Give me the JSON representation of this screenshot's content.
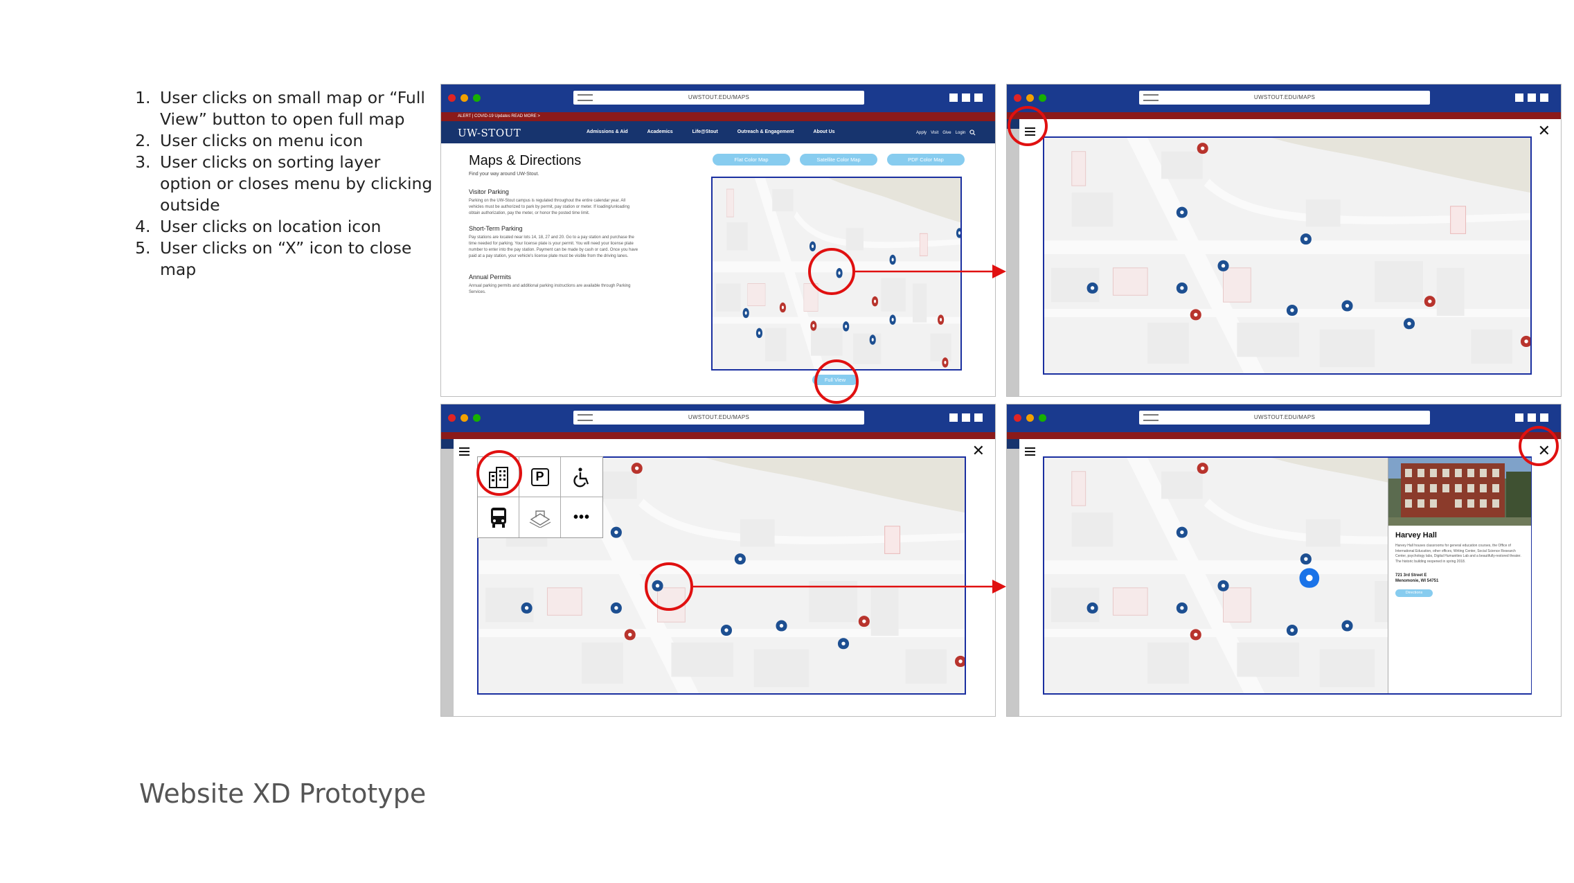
{
  "steps": [
    "User clicks on small map or “Full View” button to open full map",
    "User clicks on menu icon",
    "User clicks on sorting layer option or closes menu by clicking outside",
    "User clicks on location icon",
    "User clicks on “X” icon to close map"
  ],
  "caption": "Website XD Prototype",
  "browser": {
    "url": "UWSTOUT.EDU/MAPS"
  },
  "site": {
    "alert": "ALERT | COVID-19 Updates READ MORE >",
    "logo": "UW-STOUT",
    "nav": [
      "Admissions & Aid",
      "Academics",
      "Life@Stout",
      "Outreach & Engagement",
      "About Us"
    ],
    "nav_right": [
      "Apply",
      "Visit",
      "Give",
      "Login"
    ]
  },
  "maps_page": {
    "title": "Maps & Directions",
    "subtitle": "Find your way around UW-Stout.",
    "sections": [
      {
        "heading": "Visitor Parking",
        "text": "Parking on the UW-Stout campus is regulated throughout the entire calendar year. All vehicles must be authorized to park by permit, pay station or meter. If loading/unloading obtain authorization, pay the meter, or honor the posted time limit."
      },
      {
        "heading": "Short-Term Parking",
        "text": "Pay stations are located near lots 14, 18, 27 and 20. Go to a pay station and purchase the time needed for parking. Your license plate is your permit. You will need your license plate number to enter into the pay station. Payment can be made by cash or card. Once you have paid at a pay station, your vehicle's license plate must be visible from the driving lanes."
      },
      {
        "heading": "Annual Permits",
        "text": "Annual parking permits and additional parking instructions are available through Parking Services."
      }
    ],
    "map_buttons": [
      "Flat Color Map",
      "Satellite Color Map",
      "PDF Color Map"
    ],
    "full_view": "Full View"
  },
  "layer_menu": {
    "icons": [
      "building-icon",
      "parking-icon",
      "accessible-icon",
      "bus-icon",
      "landmark-icon",
      "more-icon"
    ],
    "more_label": "•••",
    "parking_label": "P"
  },
  "location": {
    "name": "Harvey Hall",
    "description": "Harvey Hall houses classrooms for general education courses, the Office of International Education, other offices, Writing Center, Social Science Research Center, psychology labs, Digital Humanities Lab and a beautifully-restored theater. The historic building reopened in spring 2018.",
    "address1": "721 3rd Street E",
    "address2": "Menomonie, WI 54751",
    "button": "Directions"
  },
  "close_label": "✕",
  "colors": {
    "highlight": "#e01010",
    "chrome": "#1a3a8e",
    "pin_blue": "#1d4f91",
    "pin_red": "#b8342d"
  }
}
